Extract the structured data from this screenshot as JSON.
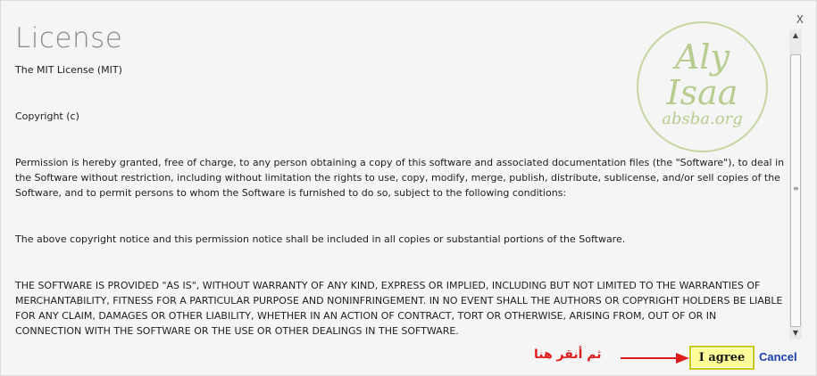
{
  "dialog": {
    "close_label": "X",
    "title": "License",
    "paragraphs": {
      "mit": "The MIT License (MIT)",
      "copyright": "Copyright (c)",
      "permission": "Permission is hereby granted, free of charge, to any person obtaining a copy of this software and associated documentation files (the \"Software\"), to deal in the Software without restriction, including without limitation the rights to use, copy, modify, merge, publish, distribute, sublicense, and/or sell copies of the Software, and to permit persons to whom the Software is furnished to do so, subject to the following conditions:",
      "notice": "The above copyright notice and this permission notice shall be included in all copies or substantial portions of the Software.",
      "warranty": "THE SOFTWARE IS PROVIDED \"AS IS\", WITHOUT WARRANTY OF ANY KIND, EXPRESS OR IMPLIED, INCLUDING BUT NOT LIMITED TO THE WARRANTIES OF MERCHANTABILITY, FITNESS FOR A PARTICULAR PURPOSE AND NONINFRINGEMENT. IN NO EVENT SHALL THE AUTHORS OR COPYRIGHT HOLDERS BE LIABLE FOR ANY CLAIM, DAMAGES OR OTHER LIABILITY, WHETHER IN AN ACTION OF CONTRACT, TORT OR OTHERWISE, ARISING FROM, OUT OF OR IN CONNECTION WITH THE SOFTWARE OR THE USE OR OTHER DEALINGS IN THE SOFTWARE."
    },
    "watermark": {
      "line1": "Aly",
      "line2": "Isaa",
      "line3": "absba.org",
      "color": "#b7cc8e"
    },
    "scrollbar": {
      "up_icon": "scroll-up-arrow",
      "down_icon": "scroll-down-arrow"
    }
  },
  "annotation": {
    "text": "ثم أنقر هنا",
    "color": "#e01b1b",
    "icon": "arrow-right-icon"
  },
  "buttons": {
    "agree_label": "I agree",
    "cancel_label": "Cancel",
    "agree_bg": "#ffff99",
    "cancel_color": "#1a3fb0"
  }
}
